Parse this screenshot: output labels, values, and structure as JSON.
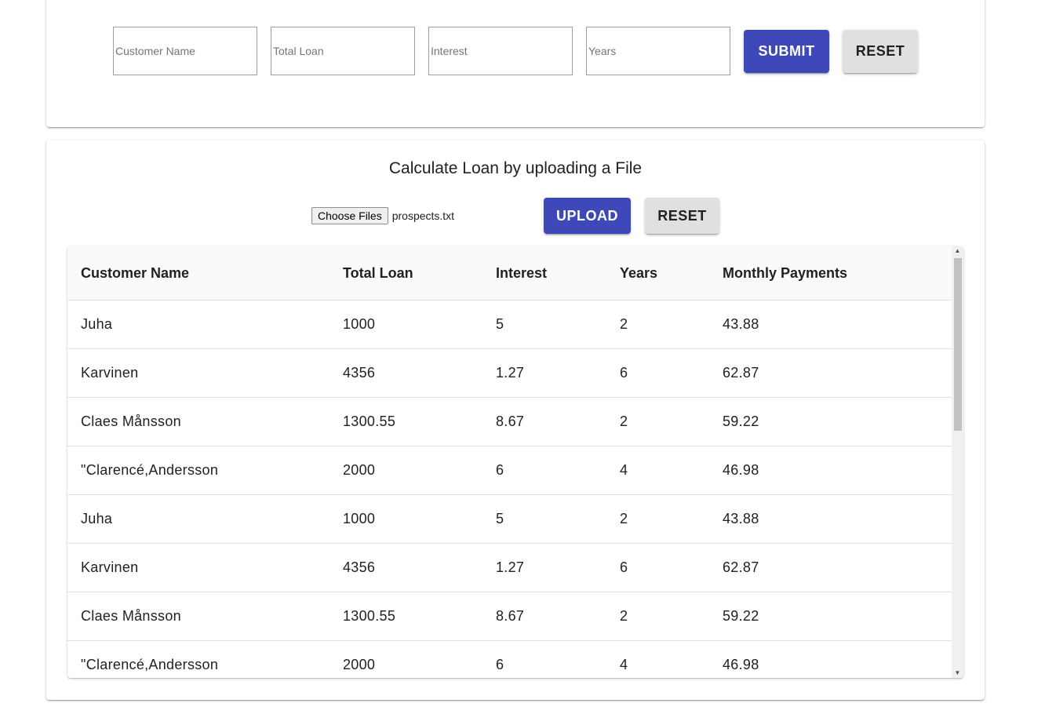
{
  "form": {
    "customer_name_placeholder": "Customer Name",
    "total_loan_placeholder": "Total Loan",
    "interest_placeholder": "Interest",
    "years_placeholder": "Years",
    "submit_label": "SUBMIT",
    "reset_label": "RESET"
  },
  "upload": {
    "title": "Calculate Loan by uploading a File",
    "choose_files_label": "Choose Files",
    "file_name": "prospects.txt",
    "upload_label": "UPLOAD",
    "reset_label": "RESET"
  },
  "table": {
    "headers": [
      "Customer Name",
      "Total Loan",
      "Interest",
      "Years",
      "Monthly Payments"
    ],
    "rows": [
      [
        "Juha",
        "1000",
        "5",
        "2",
        "43.88"
      ],
      [
        "Karvinen",
        "4356",
        "1.27",
        "6",
        "62.87"
      ],
      [
        "Claes Månsson",
        "1300.55",
        "8.67",
        "2",
        "59.22"
      ],
      [
        "\"Clarencé,Andersson",
        "2000",
        "6",
        "4",
        "46.98"
      ],
      [
        "Juha",
        "1000",
        "5",
        "2",
        "43.88"
      ],
      [
        "Karvinen",
        "4356",
        "1.27",
        "6",
        "62.87"
      ],
      [
        "Claes Månsson",
        "1300.55",
        "8.67",
        "2",
        "59.22"
      ],
      [
        "\"Clarencé,Andersson",
        "2000",
        "6",
        "4",
        "46.98"
      ]
    ]
  },
  "icons": {
    "scroll_up": "triangle-up-icon",
    "scroll_down": "triangle-down-icon"
  },
  "colors": {
    "primary": "#3f48b8",
    "default_button": "#e0e0e0"
  }
}
